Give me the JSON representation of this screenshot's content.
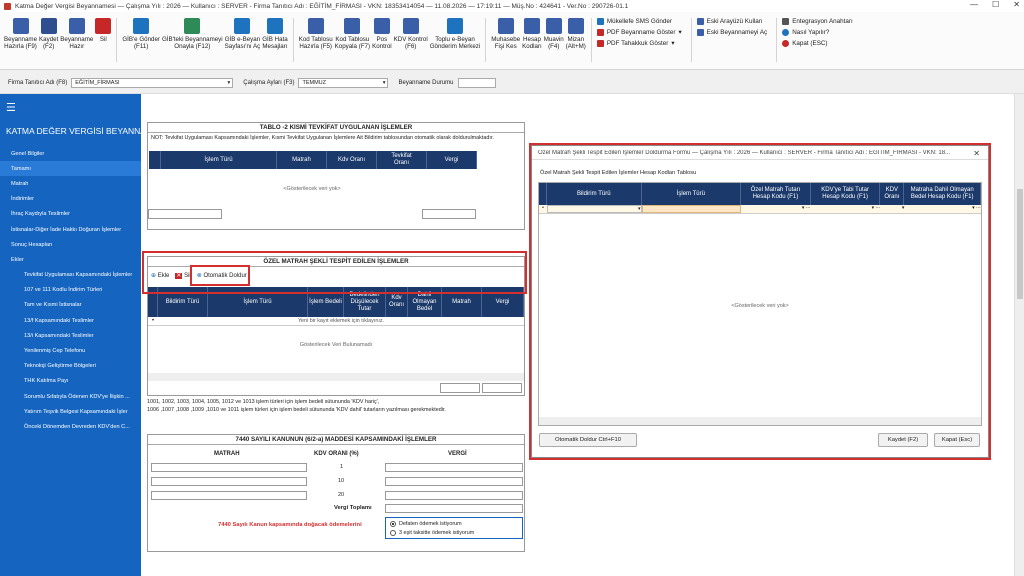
{
  "window": {
    "title": "Katma Değer Vergisi Beyannamesi  —  Çalışma Yılı : 2026   —  Kullanıcı : SERVER - Firma Tanıtıcı Adı : EĞİTİM_FİRMASI - VKN: 18353414054  —  11.08.2026  —  17:19:11  —  Müş.No : 424641  -  Ver.No : 290726-01.1"
  },
  "ribbon": {
    "buttons": [
      {
        "label": "Beyanname\nHazırla (F9)",
        "icon": "form-icon",
        "color": "#3b5ea8"
      },
      {
        "label": "Kaydet\n(F2)",
        "icon": "save-icon",
        "color": "#2e4e8f"
      },
      {
        "label": "Beyanname\nHazır",
        "icon": "document-icon",
        "color": "#3b5ea8"
      },
      {
        "label": "Sil",
        "icon": "delete-icon",
        "color": "#c62828"
      },
      {
        "label": "GİB'e Gönder\n(F11)",
        "icon": "cloud-upload-icon",
        "color": "#1e73be"
      },
      {
        "label": "GİB'teki Beyannameyi\nOnayla (F12)",
        "icon": "cloud-check-icon",
        "color": "#2e8b57"
      },
      {
        "label": "GİB e-Beyan\nSayfası'nı Aç",
        "icon": "globe-icon",
        "color": "#1e73be"
      },
      {
        "label": "GİB Hata\nMesajları",
        "icon": "error-globe-icon",
        "color": "#1e73be"
      },
      {
        "label": "Kod Tablosu\nHazırla (F5)",
        "icon": "table-icon",
        "color": "#3b5ea8"
      },
      {
        "label": "Kod Tablosu\nKopyala (F7)",
        "icon": "copy-table-icon",
        "color": "#3b5ea8"
      },
      {
        "label": "Pos\nKontrol",
        "icon": "pos-icon",
        "color": "#3b5ea8"
      },
      {
        "label": "KDV Kontrol\n(F6)",
        "icon": "check-list-icon",
        "color": "#3b5ea8"
      },
      {
        "label": "Toplu e-Beyan\nGönderim Merkezi",
        "icon": "send-center-icon",
        "color": "#1e73be"
      },
      {
        "label": "Muhasebe\nFişi Kes",
        "icon": "receipt-icon",
        "color": "#3b5ea8"
      },
      {
        "label": "Hesap\nKodları",
        "icon": "accounts-icon",
        "color": "#3b5ea8"
      },
      {
        "label": "Muavin\n(F4)",
        "icon": "ledger-icon",
        "color": "#3b5ea8"
      },
      {
        "label": "Mizan\n(Alt+M)",
        "icon": "balance-icon",
        "color": "#3b5ea8"
      }
    ],
    "list1": [
      "Mükellefe SMS Gönder",
      "PDF Beyanname Göster",
      "PDF Tahakkuk Göster"
    ],
    "list2": [
      "Eski Arayüzü Kullan",
      "Eski Beyannameyi Aç"
    ],
    "list3": [
      "Entegrasyon Anahtarı",
      "Nasıl Yapılır?",
      "Kapat (ESC)"
    ]
  },
  "filter": {
    "firma_label": "Firma Tanıtıcı Adı (F8)",
    "firma_value": "EĞİTİM_FİRMASI",
    "ay_label": "Çalışma Ayları (F3)",
    "ay_value": "TEMMUZ",
    "durum_label": "Beyanname Durumu"
  },
  "sidebar": {
    "title": "KATMA DEĞER VERGİSİ BEYANNAM...",
    "items": [
      {
        "label": "Genel Bilgiler",
        "sub": false,
        "active": false
      },
      {
        "label": "Tamamı",
        "sub": false,
        "active": true
      },
      {
        "label": "Matrah",
        "sub": false,
        "active": false
      },
      {
        "label": "İndirimler",
        "sub": false,
        "active": false
      },
      {
        "label": "İhraç Kaydıyla Teslimler",
        "sub": false,
        "active": false
      },
      {
        "label": "İstisnalar-Diğer İade Hakkı Doğuran İşlemler",
        "sub": false,
        "active": false
      },
      {
        "label": "Sonuç Hesapları",
        "sub": false,
        "active": false
      },
      {
        "label": "Ekler",
        "sub": false,
        "active": false
      },
      {
        "label": "Tevkifat Uygulaması Kapsamındaki İşlemler",
        "sub": true,
        "active": false
      },
      {
        "label": "107 ve 111 Kodlu İndirim Türleri",
        "sub": true,
        "active": false
      },
      {
        "label": "Tam ve Kısmi İstisnalar",
        "sub": true,
        "active": false
      },
      {
        "label": "13/f Kapsamındaki Teslimler",
        "sub": true,
        "active": false
      },
      {
        "label": "13/i Kapsamındaki Teslimler",
        "sub": true,
        "active": false
      },
      {
        "label": "Yenilenmiş Cep Telefonu",
        "sub": true,
        "active": false
      },
      {
        "label": "Teknoloji Geliştirme Bölgeleri",
        "sub": true,
        "active": false
      },
      {
        "label": "THK Katılma Payı",
        "sub": true,
        "active": false
      },
      {
        "label": "Sorumlu Sıfatıyla Ödenen KDV'ye İlişkin ...",
        "sub": true,
        "active": false
      },
      {
        "label": "Yatırım Teşvik Belgesi Kapsamındaki İşler",
        "sub": true,
        "active": false
      },
      {
        "label": "Önceki Dönemden Devreden KDV'den C...",
        "sub": true,
        "active": false
      }
    ]
  },
  "tablo2": {
    "title": "TABLO -2   KISMİ TEVKİFAT UYGULANAN İŞLEMLER",
    "note": "NOT: Tevkifat Uygulaması Kapsamındaki İşlemler, Kısmi Tevkifat Uygulanan İşlemlere Ait Bildirim tablosundan otomatik olarak doldurulmaktadır.",
    "columns": [
      "İşlem Türü",
      "Matrah",
      "Kdv Oranı",
      "Tevkifat\nOranı",
      "Vergi"
    ],
    "empty": "<Gösterilecek veri yok>"
  },
  "ozel": {
    "title": "ÖZEL MATRAH ŞEKLİ TESPİT EDİLEN İŞLEMLER",
    "add": "Ekle",
    "delete": "Sil",
    "auto": "Otomatik Doldur",
    "columns": [
      "Bildirim Türü",
      "İşlem Türü",
      "İşlem Bedeli",
      "Bedelinden\nDüşülecek\nTutar",
      "Kdv\nOranı",
      "Dahil\nOlmayan\nBedel",
      "Matrah",
      "Vergi"
    ],
    "newrow": "Yeni bir kayıt eklemek için tıklayınız.",
    "empty": "Gösterilecek Veri Bulunamadı",
    "footnote1": "1001, 1002, 1003, 1004, 1005, 1012 ve 1013 işlem türleri için işlem bedeli sütununda 'KDV hariç',",
    "footnote2": "1006 ,1007 ,1008 ,1009 ,1010 ve 1011 işlem türleri için işlem bedeli sütununda 'KDV dahil' tutarların yazılması gerekmektedir."
  },
  "k7440": {
    "title": "7440 SAYILI KANUNUN (6/2-a) MADDESİ KAPSAMINDAKİ İŞLEMLER",
    "matrah": "MATRAH",
    "kdv_orani": "KDV ORANI (%)",
    "vergi": "VERGİ",
    "rates": [
      "1",
      "10",
      "20"
    ],
    "vergi_toplami": "Vergi Toplamı",
    "odeme_label": "7440 Sayılı Kanun kapsamında doğacak ödemelerini",
    "option1": "Defaten ödemek istiyorum",
    "option2": "3 eşit taksitte ödemek istiyorum"
  },
  "dialog": {
    "title": "Özel Matrah Şekli Tespit Edilen İşlemler Doldurma Formu  —  Çalışma Yılı : 2026   —  Kullanıcı : SERVER - Firma Tanıtıcı Adı : EĞİTİM_FİRMASI - VKN: 18...",
    "subtitle": "Özel Matrah Şekli Tespit Edilen İşlemler Hesap Kodları Tablosu",
    "columns": [
      "Bildirim Türü",
      "İşlem Türü",
      "Özel Matrah Tutarı\nHesap Kodu (F1)",
      "KDV'ye Tabi Tutar\nHesap Kodu (F1)",
      "KDV\nOranı",
      "Matraha Dahil Olmayan\nBedel Hesap Kodu (F1)"
    ],
    "empty": "<Gösterilecek veri yok>",
    "auto_button": "Otomatik Doldur Ctrl+F10",
    "save_button": "Kaydet (F2)",
    "close_button": "Kapat (Esc)"
  },
  "colors": {
    "sidebar": "#1565c0",
    "grid_header": "#1b3a6b",
    "highlight": "#d32f2f"
  }
}
